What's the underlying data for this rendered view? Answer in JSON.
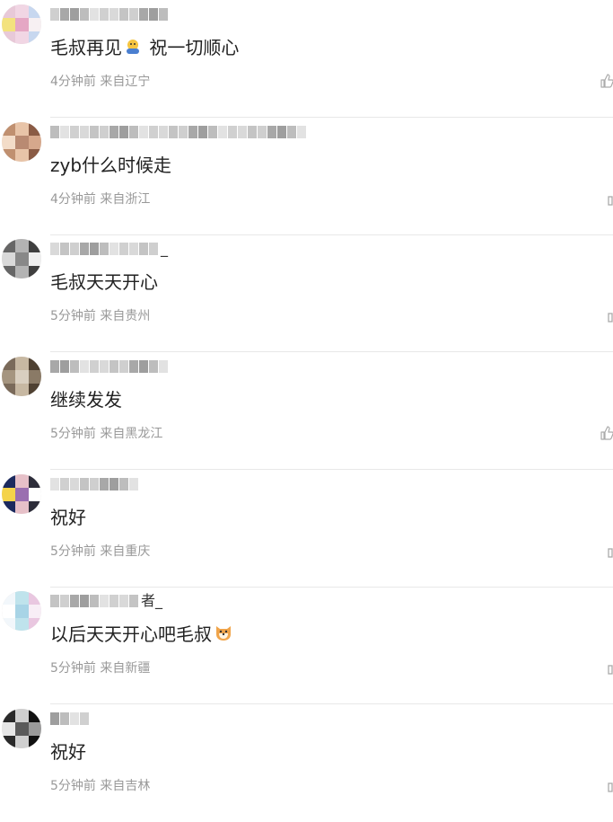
{
  "comments": [
    {
      "name_suffix": "",
      "text": "毛叔再见",
      "emoji": "hug-emoji",
      "text_after": " 祝一切顺心",
      "meta": "4分钟前 来自辽宁",
      "like": "full",
      "avatar": [
        "#e8c9d8",
        "#f1d6e4",
        "#c7d7ef",
        "#f3e27e",
        "#e5a7c4",
        "#f7f0f2"
      ],
      "name_blocks": 12
    },
    {
      "name_suffix": "",
      "text": "zyb什么时候走",
      "emoji": "",
      "text_after": "",
      "meta": "4分钟前 来自浙江",
      "like": "partial",
      "avatar": [
        "#c09070",
        "#e8c4a8",
        "#8a5b45",
        "#f3dcc8",
        "#b98a72",
        "#d6a88c"
      ],
      "name_blocks": 26
    },
    {
      "name_suffix": "_",
      "text": "毛叔天天开心",
      "emoji": "",
      "text_after": "",
      "meta": "5分钟前 来自贵州",
      "like": "partial",
      "avatar": [
        "#666666",
        "#b3b3b3",
        "#3f3f3f",
        "#d9d9d9",
        "#888888",
        "#efefef"
      ],
      "name_blocks": 11
    },
    {
      "name_suffix": "",
      "text": "继续发发",
      "emoji": "",
      "text_after": "",
      "meta": "5分钟前 来自黑龙江",
      "like": "full",
      "avatar": [
        "#7a6a5a",
        "#c7b8a2",
        "#4f4132",
        "#a59580",
        "#d9cfc0",
        "#8a7a66"
      ],
      "name_blocks": 12
    },
    {
      "name_suffix": "",
      "text": "祝好",
      "emoji": "",
      "text_after": "",
      "meta": "5分钟前 来自重庆",
      "like": "partial",
      "avatar": [
        "#1c2a5e",
        "#e6c0c8",
        "#2d2d3a",
        "#f4d34a",
        "#9a6fb0",
        "#ffffff"
      ],
      "name_blocks": 9
    },
    {
      "name_suffix": "者_",
      "text": "以后天天开心吧毛叔",
      "emoji": "dog-emoji",
      "text_after": "",
      "meta": "5分钟前 来自新疆",
      "like": "partial",
      "avatar": [
        "#f2f7fb",
        "#bfe3ec",
        "#e9c7e0",
        "#ffffff",
        "#a8d4e6",
        "#f8eef6"
      ],
      "name_blocks": 9
    },
    {
      "name_suffix": "",
      "text": "祝好",
      "emoji": "",
      "text_after": "",
      "meta": "5分钟前 来自吉林",
      "like": "partial",
      "avatar": [
        "#2a2a2a",
        "#cfcfcf",
        "#111111",
        "#e6e6e6",
        "#5a5a5a",
        "#9a9a9a"
      ],
      "name_blocks": 4
    }
  ]
}
